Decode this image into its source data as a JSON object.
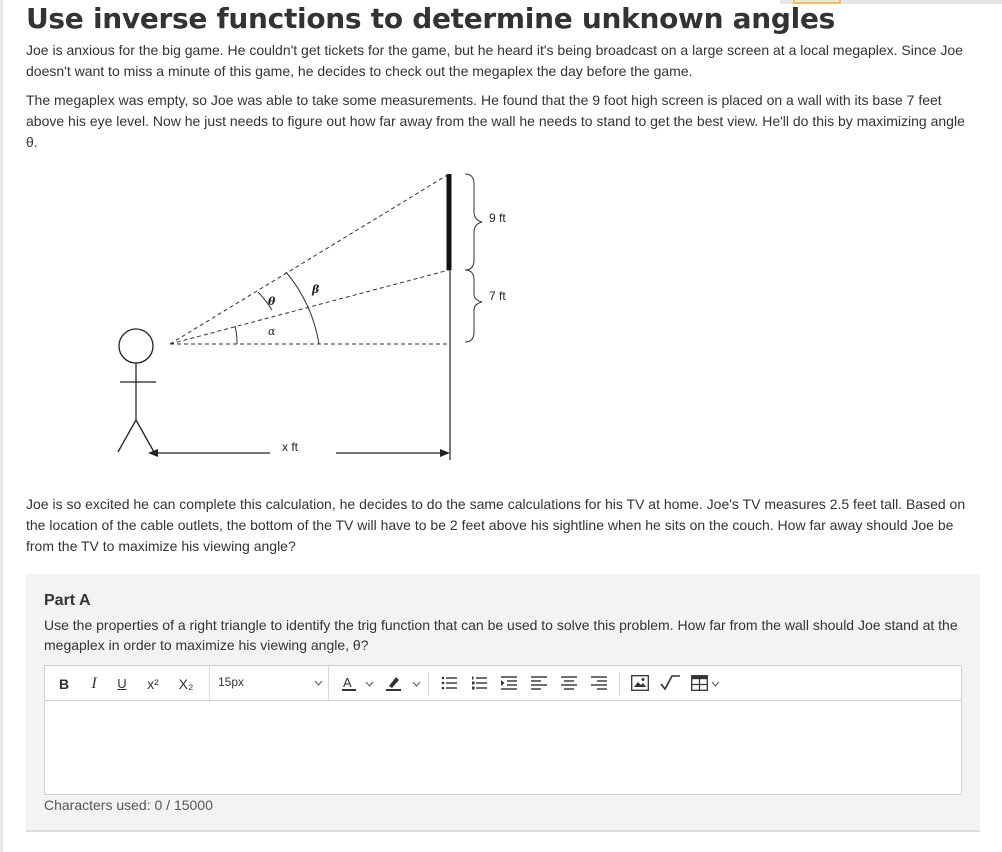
{
  "page": {
    "title": "Use inverse functions to determine unknown angles",
    "paragraphs": [
      "Joe is anxious for the big game. He couldn't get tickets for the game, but he heard it's being broadcast on a large screen at a local megaplex. Since Joe doesn't want to miss a minute of this game, he decides to check out the megaplex the day before the game.",
      "The megaplex was empty, so Joe was able to take some measurements. He found that the 9 foot high screen is placed on a wall with its base 7 feet above his eye level. Now he just needs to figure out how far away from the wall he needs to stand to get the best view. He'll do this by maximizing angle θ.",
      "Joe is so excited he can complete this calculation, he decides to do the same calculations for his TV at home. Joe's TV measures 2.5 feet tall. Based on the location of the cable outlets, the bottom of the TV will have to be 2 feet above his sightline when he sits on the couch. How far away should Joe be from the TV to maximize his viewing angle?"
    ]
  },
  "diagram": {
    "label_screen_height": "9 ft",
    "label_base_height": "7 ft",
    "label_distance": "x ft",
    "label_theta": "θ",
    "label_beta": "β",
    "label_alpha": "α"
  },
  "part_a": {
    "title": "Part A",
    "question": "Use the properties of a right triangle to identify the trig function that can be used to solve this problem. How far from the wall should Joe stand at the megaplex in order to maximize his viewing angle, θ?",
    "editor": {
      "toolbar": {
        "bold": "B",
        "italic": "I",
        "underline": "U",
        "superscript": "x²",
        "subscript": "X₂",
        "font_size": "15px"
      },
      "content": ""
    },
    "characters_label": "Characters used: 0 / 15000"
  },
  "colors": {
    "text": "#333333",
    "panel_bg": "#f3f3f3",
    "accent_tab": "#f0c24b"
  }
}
